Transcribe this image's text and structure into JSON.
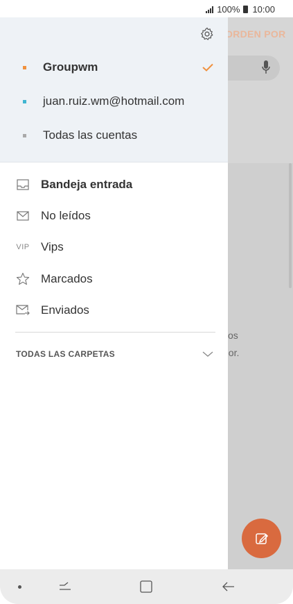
{
  "status_bar": {
    "battery": "100%",
    "time": "10:00"
  },
  "background": {
    "sort_label": "ORDEN POR",
    "partial_text_1": "cos",
    "partial_text_2": "dor."
  },
  "drawer": {
    "accounts": [
      {
        "label": "Groupwm",
        "color": "#f0913e",
        "selected": true
      },
      {
        "label": "juan.ruiz.wm@hotmail.com",
        "color": "#3fb5d1",
        "selected": false
      },
      {
        "label": "Todas las cuentas",
        "color": "#a9a9a9",
        "selected": false
      }
    ],
    "menu": [
      {
        "label": "Bandeja entrada",
        "icon": "inbox-icon",
        "bold": true
      },
      {
        "label": "No leídos",
        "icon": "envelope-icon",
        "bold": false
      },
      {
        "label": "Vips",
        "icon": "vip-icon",
        "icon_text": "VIP",
        "bold": false
      },
      {
        "label": "Marcados",
        "icon": "star-icon",
        "bold": false
      },
      {
        "label": "Enviados",
        "icon": "sent-icon",
        "bold": false
      }
    ],
    "folders_label": "TODAS LAS CARPETAS"
  },
  "colors": {
    "accent": "#f0913e",
    "fab": "#d96a3f",
    "drawer_header": "#eef2f6"
  }
}
